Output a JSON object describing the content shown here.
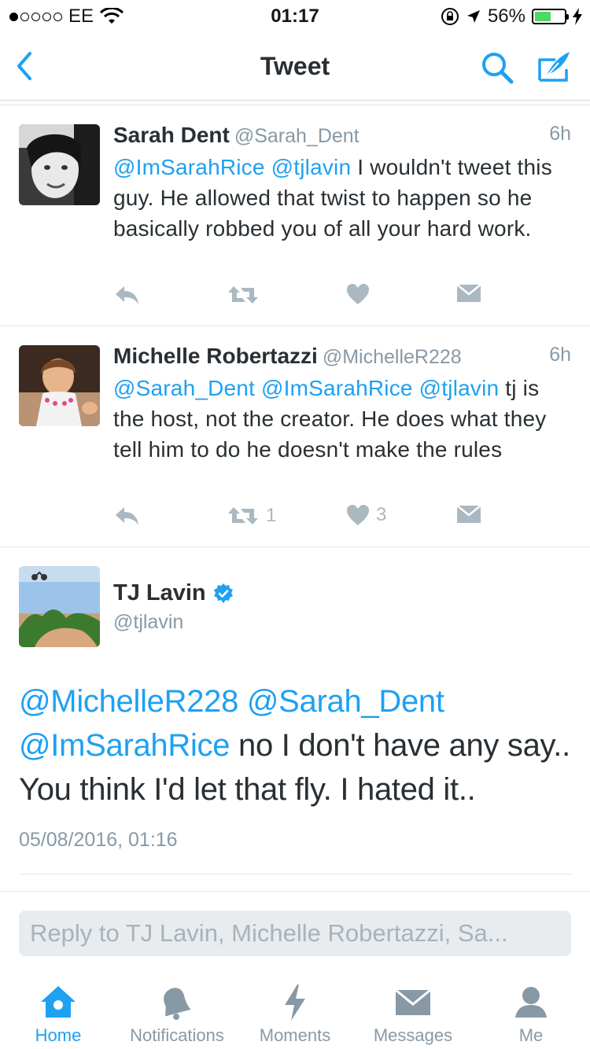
{
  "status": {
    "carrier": "EE",
    "time": "01:17",
    "battery": "56%",
    "battery_level": 0.56
  },
  "nav": {
    "title": "Tweet"
  },
  "tweets": [
    {
      "name": "Sarah Dent",
      "handle": "@Sarah_Dent",
      "time": "6h",
      "mentions": "@ImSarahRice @tjlavin",
      "text": " I wouldn't tweet this guy. He allowed that twist to happen so he basically robbed you of all your hard work.",
      "retweets": "",
      "likes": ""
    },
    {
      "name": "Michelle Robertazzi",
      "handle": "@MichelleR228",
      "time": "6h",
      "mentions": "@Sarah_Dent @ImSarahRice @tjlavin",
      "text": " tj is the host,  not the creator. He does what they tell him to do he doesn't make the rules",
      "retweets": "1",
      "likes": "3"
    }
  ],
  "main_tweet": {
    "name": "TJ Lavin",
    "handle": "@tjlavin",
    "mentions": "@MichelleR228 @Sarah_Dent @ImSarahRice",
    "text": " no I don't have any say.. You think I'd let that fly. I hated it..",
    "date": "05/08/2016, 01:16"
  },
  "reply": {
    "placeholder": "Reply to TJ Lavin, Michelle Robertazzi, Sa..."
  },
  "tabs": [
    {
      "label": "Home",
      "icon": "home-icon",
      "active": true
    },
    {
      "label": "Notifications",
      "icon": "bell-icon",
      "active": false
    },
    {
      "label": "Moments",
      "icon": "lightning-icon",
      "active": false
    },
    {
      "label": "Messages",
      "icon": "envelope-icon",
      "active": false
    },
    {
      "label": "Me",
      "icon": "person-icon",
      "active": false
    }
  ],
  "colors": {
    "accent": "#1da1f2",
    "muted": "#8899a6",
    "action_gray": "#aab8c2",
    "battery_green": "#4cd964"
  }
}
